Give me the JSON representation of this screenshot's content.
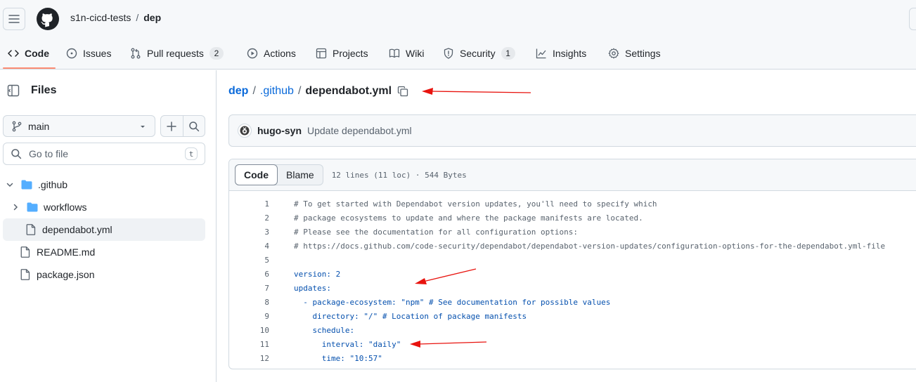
{
  "header": {
    "owner": "s1n-cicd-tests",
    "separator": "/",
    "repo": "dep"
  },
  "nav": {
    "items": [
      {
        "label": "Code",
        "icon": "code-icon",
        "selected": true
      },
      {
        "label": "Issues",
        "icon": "issue-icon"
      },
      {
        "label": "Pull requests",
        "icon": "pull-request-icon",
        "count": "2"
      },
      {
        "label": "Actions",
        "icon": "play-icon"
      },
      {
        "label": "Projects",
        "icon": "table-icon"
      },
      {
        "label": "Wiki",
        "icon": "book-icon"
      },
      {
        "label": "Security",
        "icon": "shield-icon",
        "count": "1"
      },
      {
        "label": "Insights",
        "icon": "graph-icon"
      },
      {
        "label": "Settings",
        "icon": "gear-icon"
      }
    ]
  },
  "sidebar": {
    "title": "Files",
    "branch": "main",
    "goto_placeholder": "Go to file",
    "goto_shortcut": "t",
    "tree": [
      {
        "name": ".github",
        "type": "folder",
        "expanded": true
      },
      {
        "name": "workflows",
        "type": "folder",
        "expanded": false
      },
      {
        "name": "dependabot.yml",
        "type": "file",
        "selected": true
      },
      {
        "name": "README.md",
        "type": "file"
      },
      {
        "name": "package.json",
        "type": "file"
      }
    ]
  },
  "main": {
    "path": {
      "repo": "dep",
      "sep1": "/",
      "dir": ".github",
      "sep2": "/",
      "file": "dependabot.yml"
    },
    "commit": {
      "author": "hugo-syn",
      "message": "Update dependabot.yml"
    },
    "code": {
      "tab_code": "Code",
      "tab_blame": "Blame",
      "info": "12 lines (11 loc) · 544 Bytes",
      "lines": [
        {
          "n": "1",
          "text": "# To get started with Dependabot version updates, you'll need to specify which"
        },
        {
          "n": "2",
          "text": "# package ecosystems to update and where the package manifests are located."
        },
        {
          "n": "3",
          "text": "# Please see the documentation for all configuration options:"
        },
        {
          "n": "4",
          "text": "# https://docs.github.com/code-security/dependabot/dependabot-version-updates/configuration-options-for-the-dependabot.yml-file"
        },
        {
          "n": "5",
          "text": ""
        },
        {
          "n": "6",
          "text": "version: 2"
        },
        {
          "n": "7",
          "text": "updates:"
        },
        {
          "n": "8",
          "text": "  - package-ecosystem: \"npm\" # See documentation for possible values"
        },
        {
          "n": "9",
          "text": "    directory: \"/\" # Location of package manifests"
        },
        {
          "n": "10",
          "text": "    schedule:"
        },
        {
          "n": "11",
          "text": "      interval: \"daily\""
        },
        {
          "n": "12",
          "text": "      time: \"10:57\""
        }
      ]
    }
  },
  "colors": {
    "accent_link": "#0969da",
    "nav_underline": "#fd8c73",
    "annotation_arrow": "#e8130e"
  }
}
